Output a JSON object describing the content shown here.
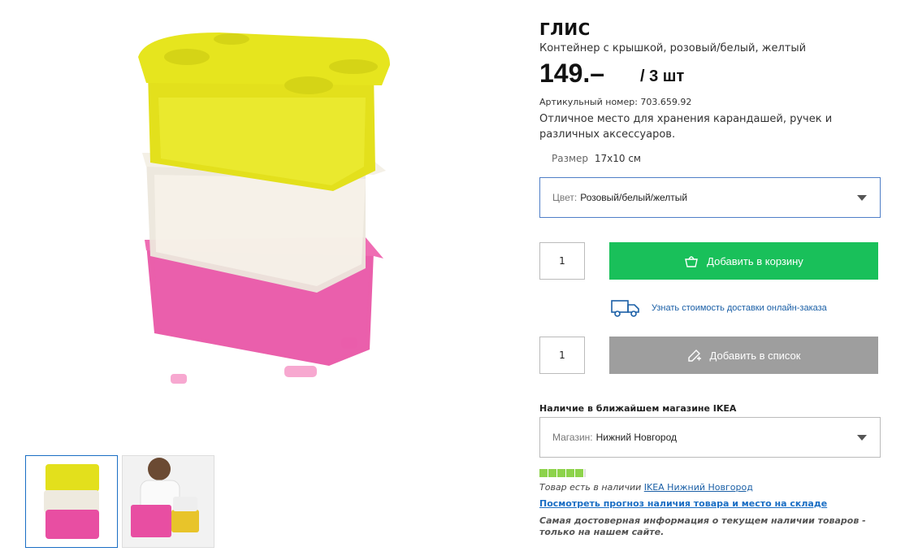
{
  "product": {
    "title": "ГЛИС",
    "subtitle": "Контейнер с крышкой, розовый/белый, желтый",
    "price": "149.–",
    "price_unit": "/ 3 шт",
    "article": "Артикульный номер: 703.659.92",
    "description": "Отличное место для хранения карандашей, ручек и различных аксессуаров.",
    "size_label": "Размер",
    "size_value": "17x10 см"
  },
  "color_select": {
    "label": "Цвет:",
    "value": "Розовый/белый/желтый"
  },
  "cart": {
    "qty": "1",
    "button_label": "Добавить в корзину",
    "accent": "#19c05a"
  },
  "delivery": {
    "link_text": "Узнать стоимость доставки онлайн-заказа"
  },
  "list": {
    "qty": "1",
    "button_label": "Добавить в список",
    "accent": "#9e9e9e"
  },
  "availability": {
    "title": "Наличие в ближайшем магазине IKEA",
    "store_label": "Магазин:",
    "store_value": "Нижний Новгород",
    "stock_level": 5,
    "in_stock_text": "Товар есть в наличии",
    "in_stock_store": "IKEA Нижний Новгород",
    "forecast_link": "Посмотреть прогноз наличия товара и место на складе",
    "note": "Самая достоверная информация о текущем наличии товаров - только на нашем сайте."
  },
  "gallery": {
    "images": [
      "containers-stack-image",
      "child-with-containers-image"
    ]
  }
}
